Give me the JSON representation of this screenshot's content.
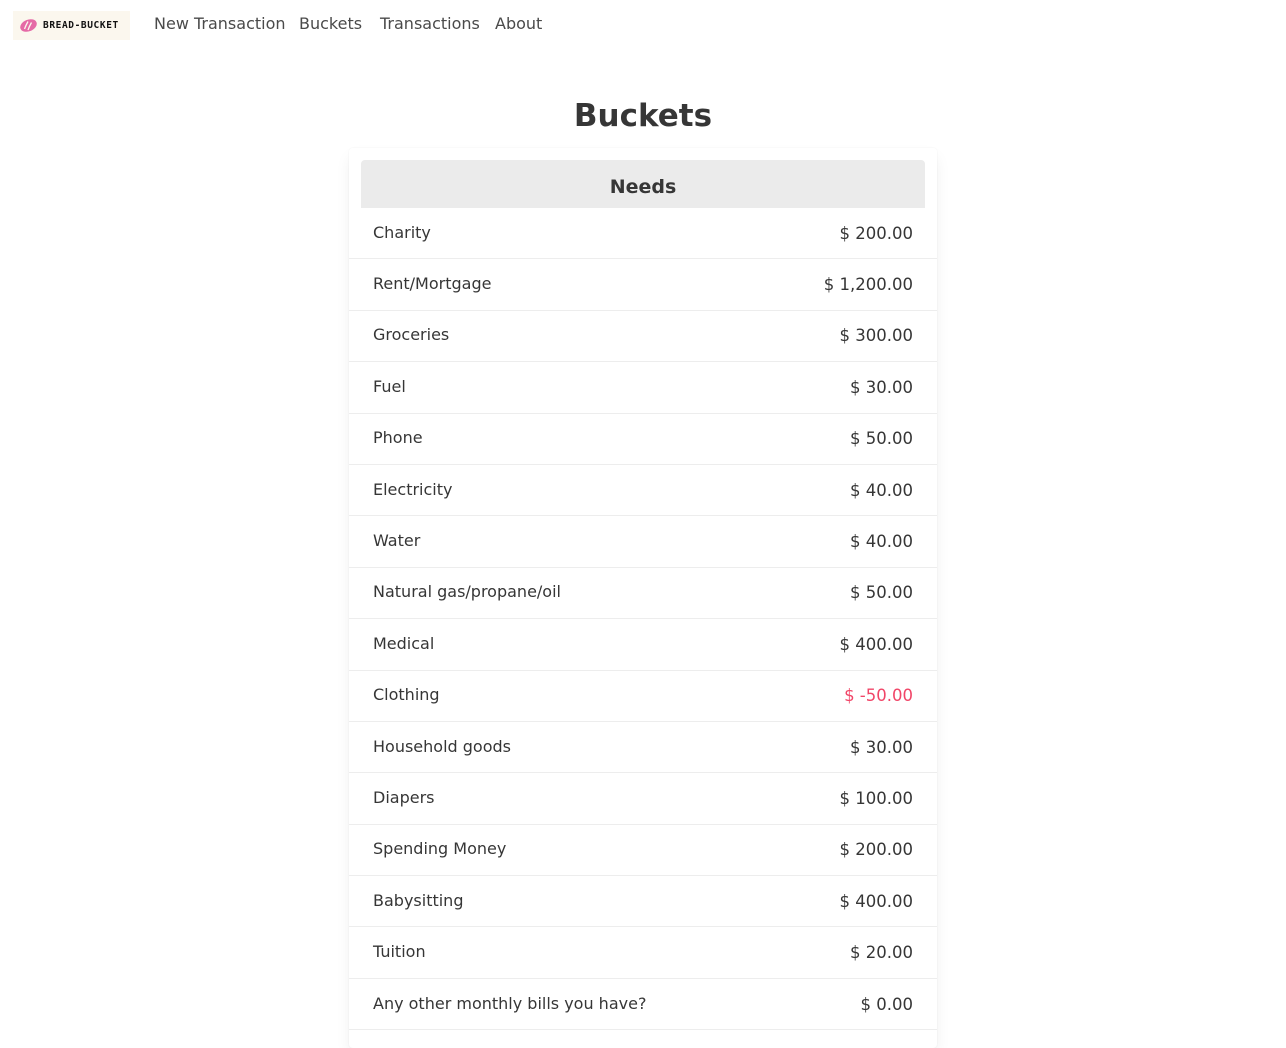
{
  "nav": {
    "brand_text": "BREAD-BUCKET",
    "brand_icon": "bread-icon",
    "items": [
      {
        "label": "New Transaction"
      },
      {
        "label": "Buckets"
      },
      {
        "label": "Transactions"
      },
      {
        "label": "About"
      }
    ]
  },
  "page": {
    "title": "Buckets"
  },
  "colors": {
    "negative": "#f14668",
    "header_bg": "#ebebeb",
    "brand_icon": "#e56aa6"
  },
  "needs": {
    "title": "Needs",
    "rows": [
      {
        "name": "Charity",
        "amount": "$ 200.00",
        "negative": false
      },
      {
        "name": "Rent/Mortgage",
        "amount": "$ 1,200.00",
        "negative": false
      },
      {
        "name": "Groceries",
        "amount": "$ 300.00",
        "negative": false
      },
      {
        "name": "Fuel",
        "amount": "$ 30.00",
        "negative": false
      },
      {
        "name": "Phone",
        "amount": "$ 50.00",
        "negative": false
      },
      {
        "name": "Electricity",
        "amount": "$ 40.00",
        "negative": false
      },
      {
        "name": "Water",
        "amount": "$ 40.00",
        "negative": false
      },
      {
        "name": "Natural gas/propane/oil",
        "amount": "$ 50.00",
        "negative": false
      },
      {
        "name": "Medical",
        "amount": "$ 400.00",
        "negative": false
      },
      {
        "name": "Clothing",
        "amount": "$ -50.00",
        "negative": true
      },
      {
        "name": "Household goods",
        "amount": "$ 30.00",
        "negative": false
      },
      {
        "name": "Diapers",
        "amount": "$ 100.00",
        "negative": false
      },
      {
        "name": "Spending Money",
        "amount": "$ 200.00",
        "negative": false
      },
      {
        "name": "Babysitting",
        "amount": "$ 400.00",
        "negative": false
      },
      {
        "name": "Tuition",
        "amount": "$ 20.00",
        "negative": false
      },
      {
        "name": "Any other monthly bills you have?",
        "amount": "$ 0.00",
        "negative": false
      }
    ]
  }
}
